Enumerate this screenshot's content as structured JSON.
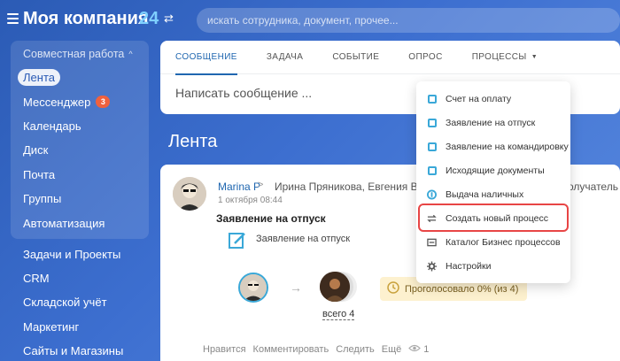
{
  "app": {
    "company_name": "Моя компания",
    "company_count": "24",
    "search_placeholder": "искать сотрудника, документ, прочее..."
  },
  "sidebar": {
    "group_title": "Совместная работа",
    "group_items": [
      {
        "label": "Лента",
        "active": true
      },
      {
        "label": "Мессенджер",
        "badge": "3"
      },
      {
        "label": "Календарь"
      },
      {
        "label": "Диск"
      },
      {
        "label": "Почта"
      },
      {
        "label": "Группы"
      },
      {
        "label": "Автоматизация"
      }
    ],
    "items": [
      {
        "label": "Задачи и Проекты"
      },
      {
        "label": "CRM"
      },
      {
        "label": "Складской учёт"
      },
      {
        "label": "Маркетинг"
      },
      {
        "label": "Сайты и Магазины"
      }
    ]
  },
  "compose": {
    "tabs": [
      {
        "label": "СООБЩЕНИЕ",
        "active": true
      },
      {
        "label": "ЗАДАЧА"
      },
      {
        "label": "СОБЫТИЕ"
      },
      {
        "label": "ОПРОС"
      },
      {
        "label": "ПРОЦЕССЫ"
      }
    ],
    "placeholder": "Написать сообщение ..."
  },
  "feed": {
    "title": "Лента",
    "post": {
      "author": "Marina P",
      "recipients": "Ирина Пряникова, Евгения Волоз",
      "recipients_tail": "олучатель",
      "date": "1 октября 08:44",
      "title": "Заявление на отпуск",
      "doc_label": "Заявление на отпуск",
      "all_label": "всего 4",
      "vote_status": "Проголосовало 0% (из 4)",
      "actions": {
        "like": "Нравится",
        "comment": "Комментировать",
        "follow": "Следить",
        "more": "Ещё",
        "views": "1"
      }
    }
  },
  "dropdown": {
    "items": [
      {
        "label": "Счет на оплату",
        "icon": "invoice-icon"
      },
      {
        "label": "Заявление на отпуск",
        "icon": "vacation-icon"
      },
      {
        "label": "Заявление на командировку",
        "icon": "trip-icon"
      },
      {
        "label": "Исходящие документы",
        "icon": "outgoing-docs-icon"
      },
      {
        "label": "Выдача наличных",
        "icon": "cash-icon"
      },
      {
        "label": "Создать новый процесс",
        "icon": "new-process-icon",
        "highlighted": true
      },
      {
        "label": "Каталог Бизнес процессов",
        "icon": "catalog-icon"
      },
      {
        "label": "Настройки",
        "icon": "gear-icon"
      }
    ]
  },
  "colors": {
    "accent": "#2067b0",
    "highlight": "#e84545",
    "badge": "#f0613d",
    "icon": "#3aa8d8"
  }
}
